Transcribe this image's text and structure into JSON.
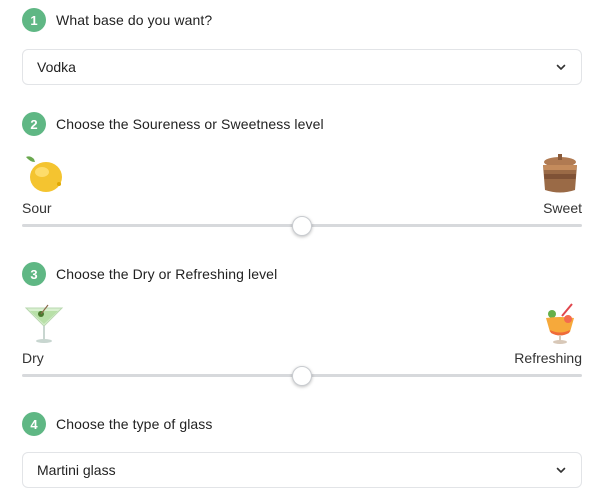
{
  "accent_color": "#5fb784",
  "steps": [
    {
      "number": "1",
      "title": "What base do you want?"
    },
    {
      "number": "2",
      "title": "Choose the Soureness or Sweetness level"
    },
    {
      "number": "3",
      "title": "Choose the Dry or Refreshing level"
    },
    {
      "number": "4",
      "title": "Choose the type of glass"
    }
  ],
  "base_select": {
    "value": "Vodka",
    "icon": "chevron-down-icon"
  },
  "sweetness_slider": {
    "left_label": "Sour",
    "left_icon": "lemon-icon",
    "right_label": "Sweet",
    "right_icon": "honey-pot-icon",
    "value_fraction": 0.5
  },
  "refreshing_slider": {
    "left_label": "Dry",
    "left_icon": "martini-glass-icon",
    "right_label": "Refreshing",
    "right_icon": "tropical-drink-icon",
    "value_fraction": 0.5
  },
  "glass_select": {
    "value": "Martini glass",
    "icon": "chevron-down-icon"
  }
}
